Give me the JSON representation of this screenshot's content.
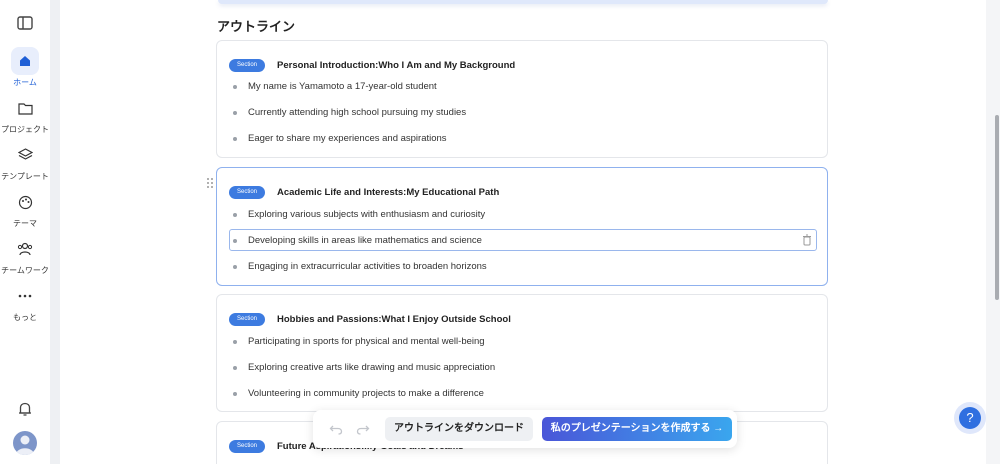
{
  "sidebar": {
    "items": [
      {
        "label": "ホーム",
        "icon": "home-icon",
        "active": true
      },
      {
        "label": "プロジェクト",
        "icon": "folder-icon"
      },
      {
        "label": "テンプレート",
        "icon": "layers-icon"
      },
      {
        "label": "テーマ",
        "icon": "palette-icon"
      },
      {
        "label": "チームワーク",
        "icon": "team-icon"
      },
      {
        "label": "もっと",
        "icon": "more-icon"
      }
    ]
  },
  "outline": {
    "title": "アウトライン",
    "sections": [
      {
        "badge": "Section",
        "title": "Personal Introduction:Who I Am and My Background",
        "bullets": [
          "My name is Yamamoto a 17-year-old student",
          "Currently attending high school pursuing my studies",
          "Eager to share my experiences and aspirations"
        ]
      },
      {
        "badge": "Section",
        "title": "Academic Life and Interests:My Educational Path",
        "bullets": [
          "Exploring various subjects with enthusiasm and curiosity",
          "Developing skills in areas like mathematics and science",
          "Engaging in extracurricular activities to broaden horizons"
        ]
      },
      {
        "badge": "Section",
        "title": "Hobbies and Passions:What I Enjoy Outside School",
        "bullets": [
          "Participating in sports for physical and mental well-being",
          "Exploring creative arts like drawing and music appreciation",
          "Volunteering in community projects to make a difference"
        ]
      },
      {
        "badge": "Section",
        "title": "Future Aspirations:My Goals and Dreams",
        "bullets": []
      }
    ]
  },
  "toolbar": {
    "download_label": "アウトラインをダウンロード",
    "create_label": "私のプレゼンテーションを作成する →"
  },
  "help": {
    "label": "?"
  },
  "colors": {
    "accent": "#3d7be0",
    "selected_border": "#8fb1ee"
  }
}
